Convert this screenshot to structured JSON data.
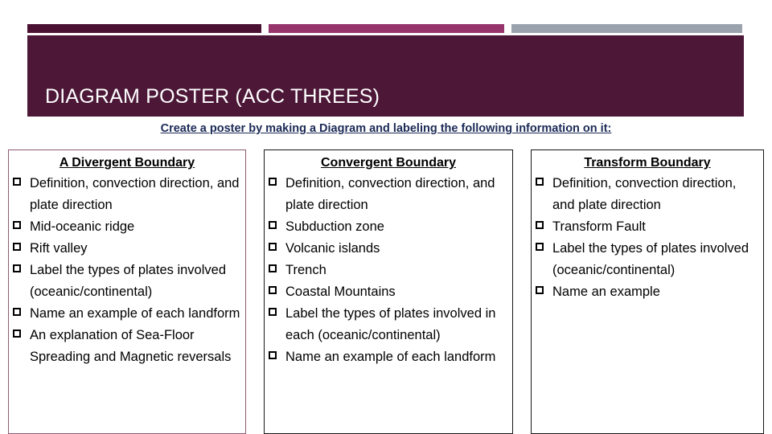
{
  "theme": {
    "bar_dark": "#4a1132",
    "bar_pink": "#95356b",
    "bar_gray": "#9aa3ad",
    "title_band": "#4d1838",
    "title_text": "#ffffff",
    "subtitle_text": "#1b2a56",
    "box1_border": "#8e5a72",
    "box_border": "#161616",
    "body_text": "#000000"
  },
  "header": {
    "title": "DIAGRAM POSTER (ACC THREES)"
  },
  "subtitle": {
    "text": "Create a poster by making a Diagram and labeling the following information on it:"
  },
  "bullet_glyph": "❑",
  "columns": [
    {
      "heading": "A Divergent Boundary",
      "items": [
        "Definition, convection direction, and plate direction",
        "Mid-oceanic ridge",
        "Rift valley",
        "Label the types of plates involved (oceanic/continental)",
        "Name an example of each landform",
        "An explanation of Sea-Floor Spreading and Magnetic reversals"
      ]
    },
    {
      "heading": "Convergent Boundary",
      "items": [
        "Definition, convection direction, and plate direction",
        "Subduction zone",
        "Volcanic islands",
        "Trench",
        "Coastal Mountains",
        " Label the types of plates involved in each (oceanic/continental)",
        "Name an example of each landform"
      ]
    },
    {
      "heading": "Transform Boundary",
      "items": [
        "Definition, convection direction, and plate direction",
        "Transform Fault",
        "Label the types of plates involved (oceanic/continental)",
        "Name an example"
      ]
    }
  ]
}
